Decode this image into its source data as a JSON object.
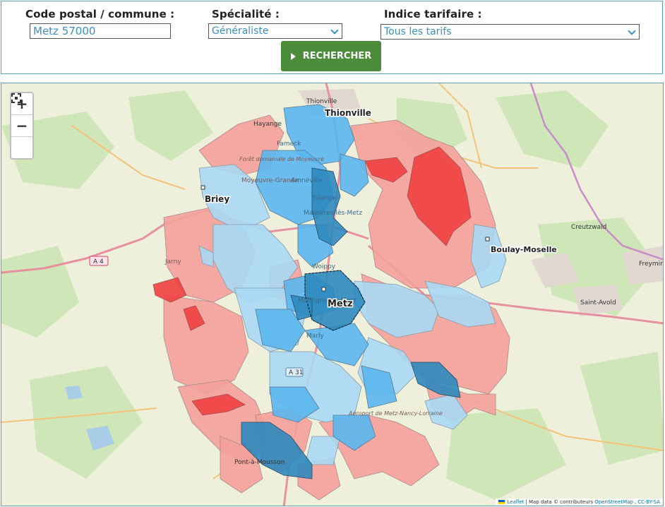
{
  "form": {
    "postal_label": "Code postal / commune :",
    "postal_value": "Metz 57000",
    "specialty_label": "Spécialité :",
    "specialty_value": "Généraliste",
    "tariff_label": "Indice tarifaire :",
    "tariff_value": "Tous les tarifs",
    "search_label": "RECHERCHER"
  },
  "map": {
    "zoom_in": "+",
    "zoom_out": "−",
    "cities": {
      "thionville": "Thionville",
      "metz": "Metz",
      "briey": "Briey",
      "boulay": "Boulay-Moselle"
    },
    "places": {
      "thionville_small": "Thionville",
      "hayange": "Hayange",
      "fameck": "Fameck",
      "moyeuvre": "Moyeuvre-Grande",
      "amneville": "Amnéville",
      "talange": "Talange",
      "maizieres": "Maizières-lès-Metz",
      "woippy": "Woippy",
      "montigny": "Montigny-lès-Metz",
      "marly": "Marly",
      "jarny": "Jarny",
      "a4": "A 4",
      "a31": "A 31",
      "creutzwald": "Creutzwald",
      "saint_avold": "Saint-Avold",
      "freyming": "Freyming-Merlebach",
      "pont": "Pont-à-Mousson",
      "aeroport": "Aéroport de Metz-Nancy-Lorraine",
      "foret": "Forêt domaniale de Moyeuvre"
    },
    "colors": {
      "red_light": "#f4a09a",
      "red_strong": "#f04040",
      "blue_light": "#a9d8f4",
      "blue_mid": "#5ab6ee",
      "blue_dark": "#2e88be"
    }
  },
  "attribution": {
    "leaflet": "Leaflet",
    "text": " | Map data © contributeurs ",
    "osm": "OpenStreetMap",
    "sep": ", ",
    "license": "CC-BY-SA"
  }
}
